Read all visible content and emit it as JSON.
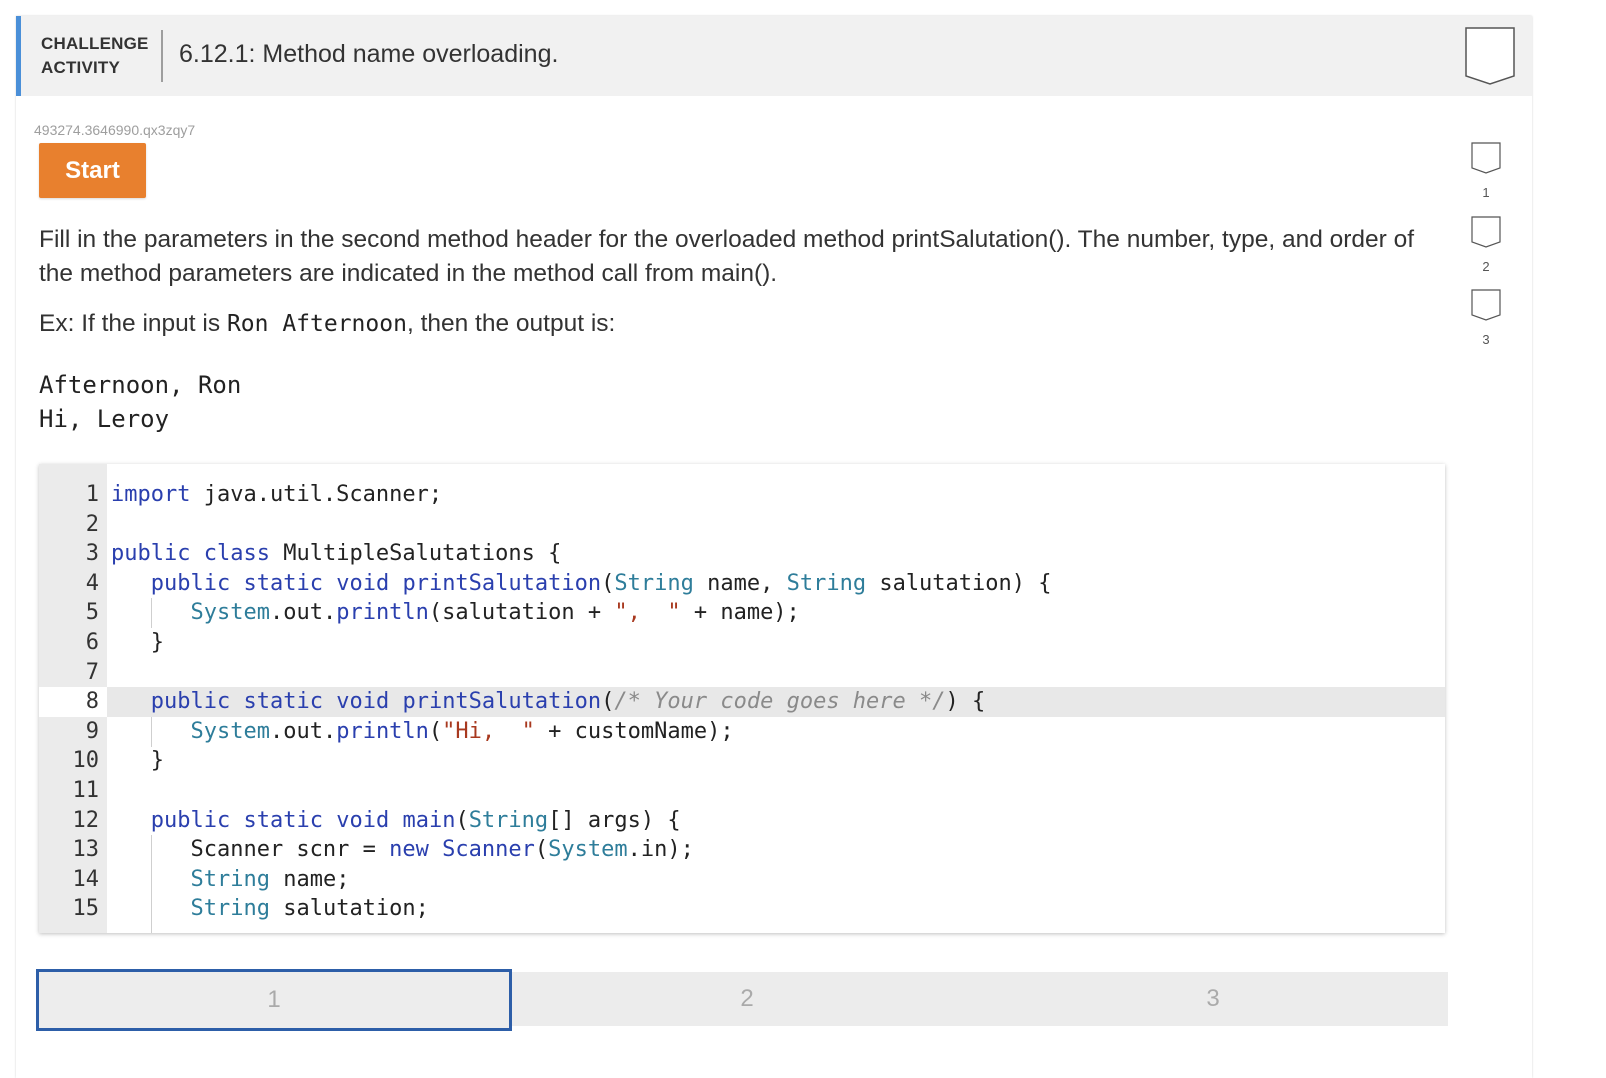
{
  "header": {
    "activity_label_line1": "CHALLENGE",
    "activity_label_line2": "ACTIVITY",
    "title": "6.12.1: Method name overloading."
  },
  "activity_id": "493274.3646990.qx3zqy7",
  "start_button": "Start",
  "instructions": "Fill in the parameters in the second method header for the overloaded method printSalutation(). The number, type, and order of the method parameters are indicated in the method call from main().",
  "example": {
    "prefix": "Ex: If the input is ",
    "input": "Ron Afternoon",
    "suffix": ", then the output is:"
  },
  "expected_output": "Afternoon, Ron\nHi, Leroy",
  "code_editor": {
    "line_numbers": [
      "1",
      "2",
      "3",
      "4",
      "5",
      "6",
      "7",
      "8",
      "9",
      "10",
      "11",
      "12",
      "13",
      "14",
      "15"
    ],
    "active_line": 8,
    "placeholder_comment": "/* Your code goes here */"
  },
  "level_tabs": [
    "1",
    "2",
    "3"
  ],
  "active_level": "1",
  "side_levels": [
    "1",
    "2",
    "3"
  ],
  "colors": {
    "accent_blue": "#4a8fd8",
    "start_orange": "#e8802e",
    "keyword": "#2a3fae",
    "type": "#2e7d9a",
    "string": "#a8391f",
    "comment": "#8a8a8a"
  }
}
